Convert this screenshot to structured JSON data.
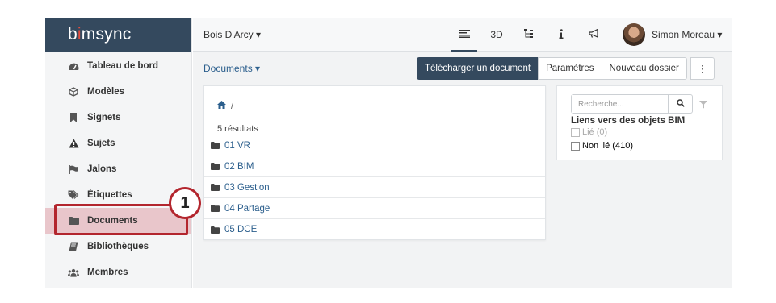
{
  "brand": {
    "logo_pre": "b",
    "logo_accent": "i",
    "logo_post": "msync"
  },
  "sidebar": {
    "items": [
      {
        "label": "Tableau de bord",
        "icon": "dashboard-icon"
      },
      {
        "label": "Modèles",
        "icon": "cube-icon"
      },
      {
        "label": "Signets",
        "icon": "bookmark-icon"
      },
      {
        "label": "Sujets",
        "icon": "warning-icon"
      },
      {
        "label": "Jalons",
        "icon": "flag-icon"
      },
      {
        "label": "Étiquettes",
        "icon": "tags-icon"
      },
      {
        "label": "Documents",
        "icon": "folder-icon",
        "active": true
      },
      {
        "label": "Bibliothèques",
        "icon": "book-icon"
      },
      {
        "label": "Membres",
        "icon": "users-icon"
      }
    ]
  },
  "annotation": {
    "step": "1",
    "color": "#b3262e"
  },
  "topbar": {
    "project": "Bois D'Arcy ▾",
    "view_3d": "3D",
    "user_name": "Simon Moreau ▾"
  },
  "subbar": {
    "section": "Documents ▾",
    "upload": "Télécharger un document",
    "settings": "Paramètres",
    "new_folder": "Nouveau dossier",
    "more": "⋮"
  },
  "files": {
    "breadcrumb_sep": "/",
    "count": "5 résultats",
    "folders": [
      "01 VR",
      "02 BIM",
      "03 Gestion",
      "04 Partage",
      "05 DCE"
    ]
  },
  "filter": {
    "search_placeholder": "Recherche...",
    "title": "Liens vers des objets BIM",
    "linked": "Lié (0)",
    "unlinked": "Non lié (410)"
  },
  "colors": {
    "header": "#34495e",
    "link": "#2c5f8d",
    "active_bg": "#e9c6cb",
    "accent": "#e74c3c"
  }
}
